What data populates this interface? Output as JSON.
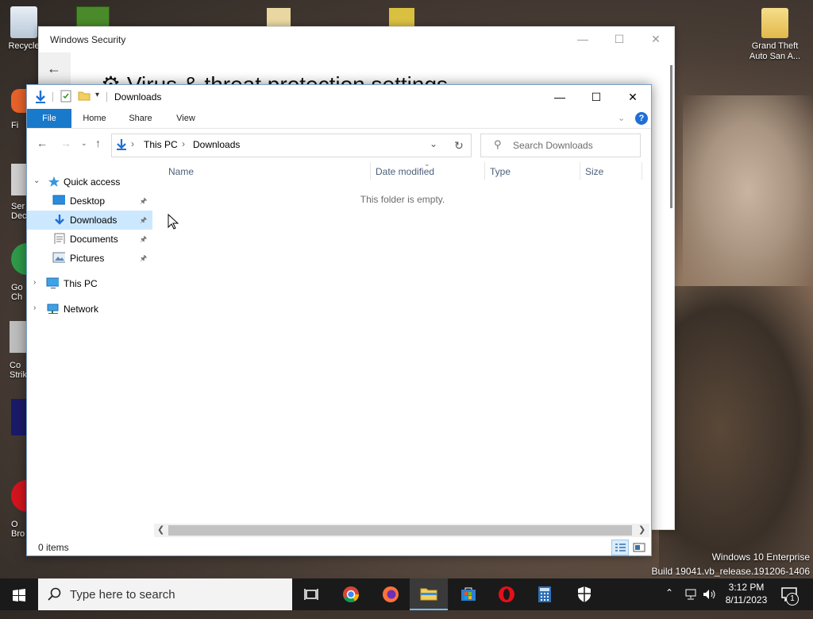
{
  "desktop": {
    "icons": [
      {
        "label": "Recycle"
      },
      {
        "label": "Grand Theft Auto San A..."
      }
    ],
    "left_partial_labels": [
      "Fi",
      "Ser",
      "Dec",
      "Go",
      "Ch",
      "Co",
      "Strik",
      "O",
      "Bro"
    ]
  },
  "windows_security": {
    "title": "Windows Security",
    "heading": "Virus & threat protection settings"
  },
  "explorer": {
    "title": "Downloads",
    "ribbon_tabs": [
      "File",
      "Home",
      "Share",
      "View"
    ],
    "help": "?",
    "breadcrumb": [
      "This PC",
      "Downloads"
    ],
    "search_placeholder": "Search Downloads",
    "nav": {
      "quick_access": "Quick access",
      "items": [
        "Desktop",
        "Downloads",
        "Documents",
        "Pictures"
      ],
      "this_pc": "This PC",
      "network": "Network"
    },
    "columns": [
      "Name",
      "Date modified",
      "Type",
      "Size"
    ],
    "empty_message": "This folder is empty.",
    "status": "0 items"
  },
  "watermark": {
    "line1": "Windows 10 Enterprise",
    "line2": "Build 19041.vb_release.191206-1406"
  },
  "taskbar": {
    "search_placeholder": "Type here to search",
    "clock_time": "3:12 PM",
    "clock_date": "8/11/2023",
    "notification_count": "1"
  },
  "colors": {
    "accent": "#1979ca",
    "selection": "#cce8ff",
    "taskbar": "#1a1a1a"
  }
}
